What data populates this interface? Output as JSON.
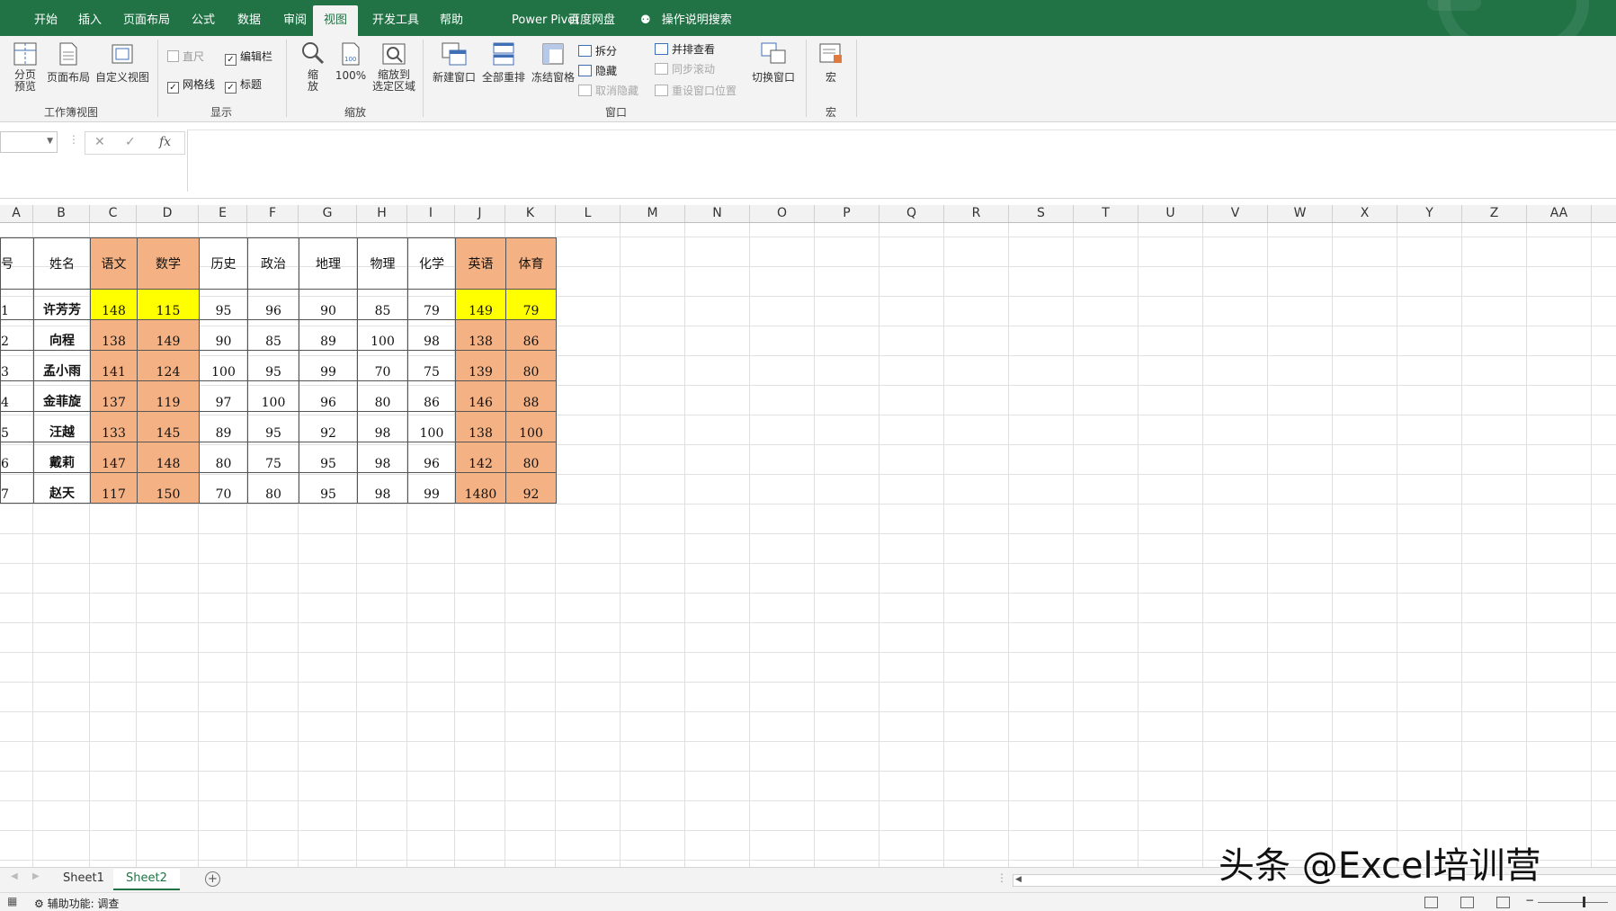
{
  "tabs": [
    "开始",
    "插入",
    "页面布局",
    "公式",
    "数据",
    "审阅",
    "视图",
    "开发工具",
    "帮助",
    "Power Pivot",
    "百度网盘"
  ],
  "active_tab": "视图",
  "tell_me": "操作说明搜索",
  "ribbon": {
    "workbook_views": {
      "label": "工作簿视图",
      "page_break": "分页\n预览",
      "page_layout": "页面布局",
      "custom_views": "自定义视图"
    },
    "show": {
      "label": "显示",
      "ruler": "直尺",
      "formula_bar": "编辑栏",
      "gridlines": "网格线",
      "headings": "标题"
    },
    "zoom": {
      "label": "缩放",
      "zoom": "缩\n放",
      "hundred": "100%",
      "zoom_selection": "缩放到\n选定区域"
    },
    "window": {
      "label": "窗口",
      "new_window": "新建窗口",
      "arrange_all": "全部重排",
      "freeze_panes": "冻结窗格",
      "split": "拆分",
      "hide": "隐藏",
      "unhide": "取消隐藏",
      "side_by_side": "并排查看",
      "sync_scroll": "同步滚动",
      "reset_position": "重设窗口位置",
      "switch_windows": "切换窗口"
    },
    "macros": {
      "label": "宏",
      "macros": "宏"
    }
  },
  "columns": [
    "A",
    "B",
    "C",
    "D",
    "E",
    "F",
    "G",
    "H",
    "I",
    "J",
    "K",
    "L",
    "M",
    "N",
    "O",
    "P",
    "Q",
    "R",
    "S",
    "T",
    "U",
    "V",
    "W",
    "X",
    "Y",
    "Z",
    "AA"
  ],
  "table": {
    "headers": [
      "序号",
      "姓名",
      "语文",
      "数学",
      "历史",
      "政治",
      "地理",
      "物理",
      "化学",
      "英语",
      "体育"
    ],
    "rows": [
      [
        "1",
        "许芳芳",
        "148",
        "115",
        "95",
        "96",
        "90",
        "85",
        "79",
        "149",
        "79"
      ],
      [
        "2",
        "向程",
        "138",
        "149",
        "90",
        "85",
        "89",
        "100",
        "98",
        "138",
        "86"
      ],
      [
        "3",
        "孟小雨",
        "141",
        "124",
        "100",
        "95",
        "99",
        "70",
        "75",
        "139",
        "80"
      ],
      [
        "4",
        "金菲旋",
        "137",
        "119",
        "97",
        "100",
        "96",
        "80",
        "86",
        "146",
        "88"
      ],
      [
        "5",
        "汪越",
        "133",
        "145",
        "89",
        "95",
        "92",
        "98",
        "100",
        "138",
        "100"
      ],
      [
        "6",
        "戴莉",
        "147",
        "148",
        "80",
        "75",
        "95",
        "98",
        "96",
        "142",
        "80"
      ],
      [
        "7",
        "赵天",
        "117",
        "150",
        "70",
        "80",
        "95",
        "98",
        "99",
        "1480",
        "92"
      ]
    ],
    "colors": {
      "orange": "#f4b183",
      "yellow": "#ffff00"
    }
  },
  "sheets": [
    "Sheet1",
    "Sheet2"
  ],
  "active_sheet": "Sheet2",
  "status": {
    "accessibility": "辅助功能: 调查"
  },
  "watermark": "头条 @Excel培训营"
}
